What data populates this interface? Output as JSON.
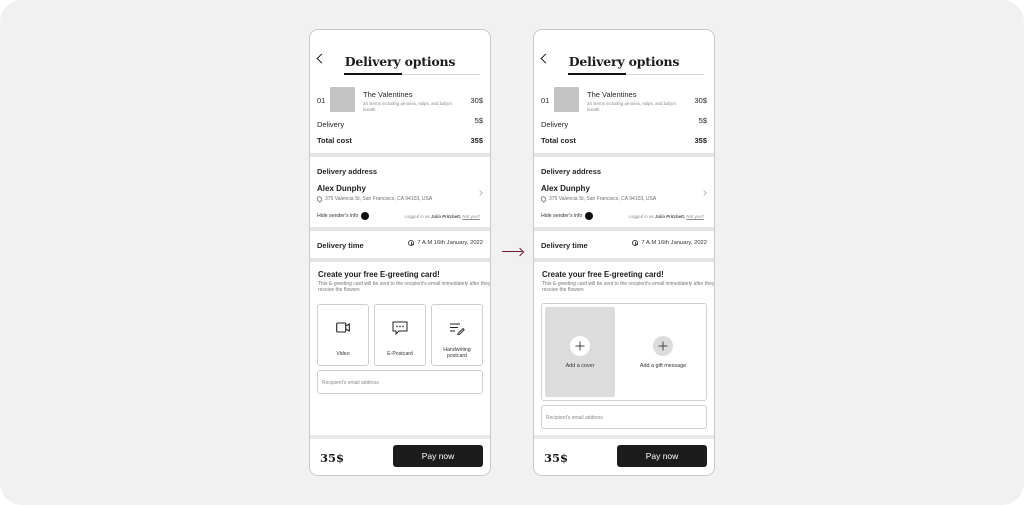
{
  "header": {
    "title": "Delivery options"
  },
  "order": {
    "index": "01",
    "product_name": "The Valentines",
    "product_desc": "20 stems including peonies, tulips, and baby's breath",
    "product_price": "30$",
    "delivery_label": "Delivery",
    "delivery_price": "5$",
    "total_label": "Total cost",
    "total_price": "35$"
  },
  "address": {
    "section_title": "Delivery address",
    "name": "Alex Dunphy",
    "line": "375 Valencia St, San Francisco, CA 94103, USA",
    "hide_label": "Hide sender's info",
    "logged_prefix": "Logged in as",
    "logged_user": "Julia Pritchett.",
    "not_you": "Not you?"
  },
  "delivery_time": {
    "label": "Delivery time",
    "value": "7 A.M 16th January, 2022"
  },
  "egreeting": {
    "title": "Create your free E-greeting card!",
    "desc": "This E-greeting card will be sent to the recipient's email immediately after they receive the flowers",
    "options": [
      "Video",
      "E-Postcard",
      "Handwriting postcard"
    ],
    "add_cover": "Add a cover",
    "add_gift_message": "Add a gift message",
    "email_placeholder": "Recipient's email address"
  },
  "footer": {
    "price": "35$",
    "pay_label": "Pay now"
  },
  "icons": [
    "back-chevron-icon",
    "location-pin-icon",
    "chevron-right-icon",
    "clock-icon",
    "video-camera-icon",
    "chat-bubble-icon",
    "handwriting-icon",
    "plus-icon",
    "arrow-right-icon"
  ],
  "colors": {
    "background": "#f1f1f1",
    "primary_button": "#1c1c1c",
    "arrow": "#6a1a2e"
  }
}
